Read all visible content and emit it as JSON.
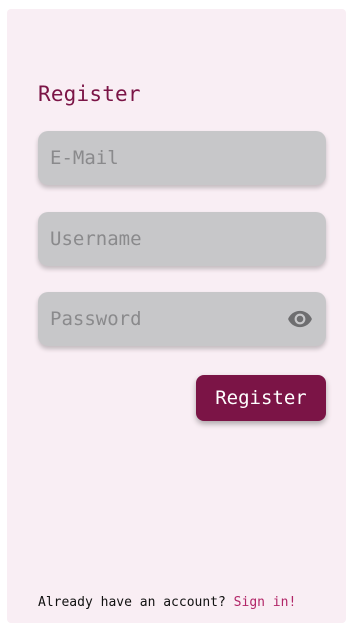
{
  "screen": {
    "title": "Register",
    "colors": {
      "background": "#f9eef4",
      "accent": "#7b1446",
      "field_fill": "#c7c7c9",
      "link": "#b12567"
    }
  },
  "form": {
    "email": {
      "placeholder": "E-Mail",
      "value": ""
    },
    "username": {
      "placeholder": "Username",
      "value": ""
    },
    "password": {
      "placeholder": "Password",
      "value": "",
      "toggle_icon": "eye-icon"
    },
    "submit_label": "Register"
  },
  "footer": {
    "prompt": "Already have an account? ",
    "link_label": "Sign in!"
  }
}
